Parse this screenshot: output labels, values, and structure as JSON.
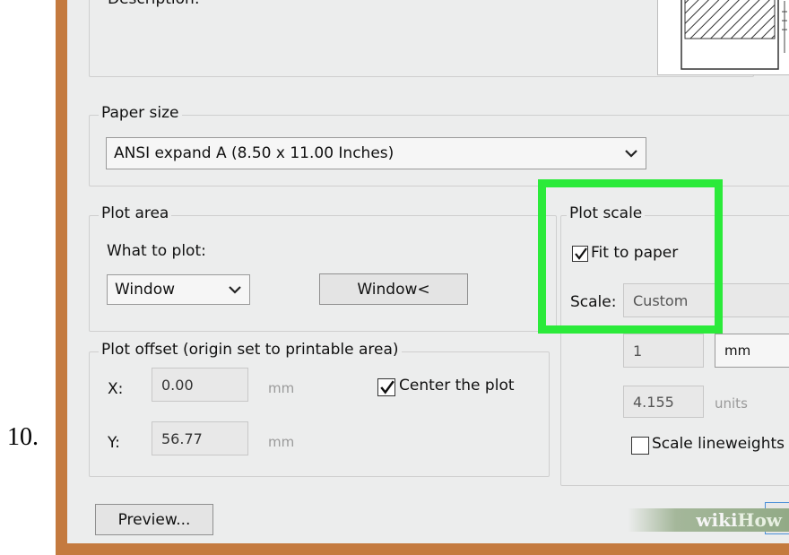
{
  "step_number": "10.",
  "description": {
    "label": "Description:"
  },
  "paper_size": {
    "legend": "Paper size",
    "selected": "ANSI expand A (8.50 x 11.00 Inches)"
  },
  "plot_area": {
    "legend": "Plot area",
    "what_to_plot_label": "What to plot:",
    "selected": "Window",
    "window_button": "Window<"
  },
  "plot_scale": {
    "legend": "Plot scale",
    "fit_to_paper": {
      "label": "Fit to paper",
      "checked": true
    },
    "scale_label": "Scale:",
    "scale_value": "Custom",
    "value1": "1",
    "unit1": "mm",
    "value2": "4.155",
    "unit2": "units",
    "scale_lineweights": {
      "label": "Scale lineweights",
      "checked": false
    }
  },
  "plot_offset": {
    "legend": "Plot offset (origin set to printable area)",
    "x_label": "X:",
    "x_value": "0.00",
    "x_unit": "mm",
    "y_label": "Y:",
    "y_value": "56.77",
    "y_unit": "mm",
    "center_the_plot": {
      "label": "Center the plot",
      "checked": true
    }
  },
  "preview_button": "Preview...",
  "watermark": {
    "wiki": "wiki",
    "how": "How"
  },
  "colors": {
    "highlight": "#2bea3a",
    "frame": "#c47a3f"
  }
}
